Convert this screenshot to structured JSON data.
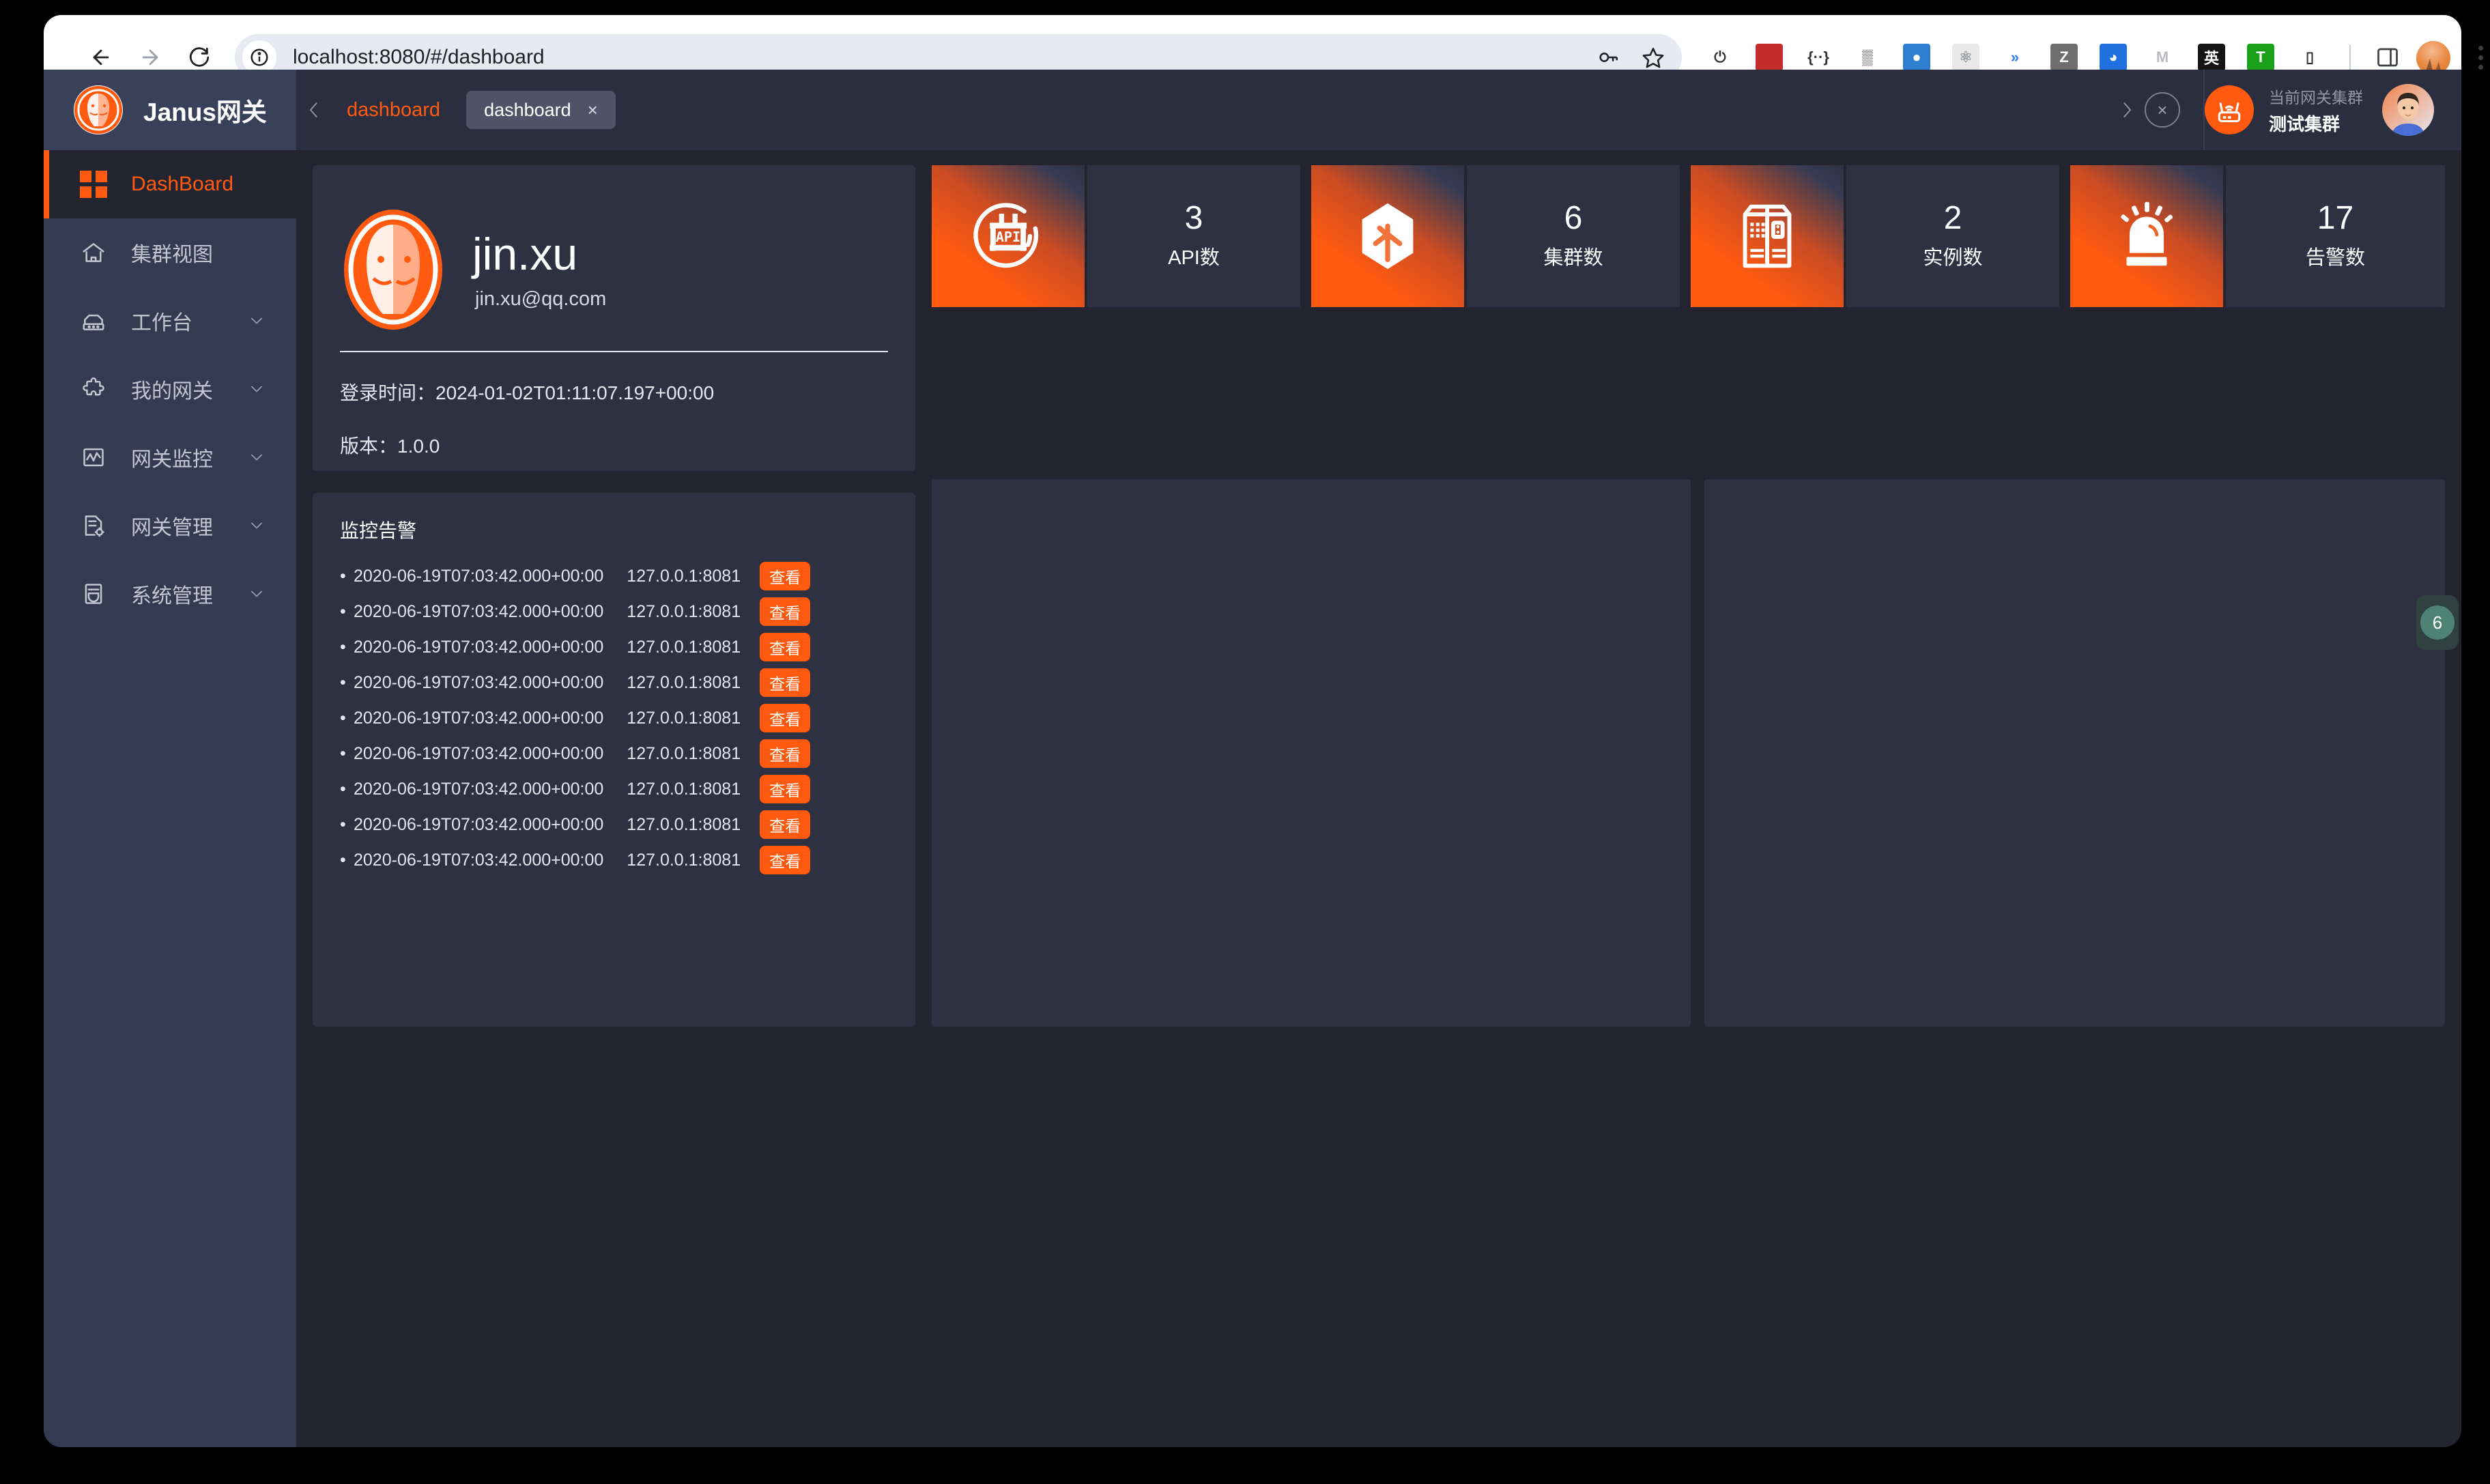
{
  "browser": {
    "url": "localhost:8080/#/dashboard",
    "nav": {
      "back": "back-arrow",
      "forward": "forward-arrow",
      "reload": "reload"
    },
    "omnibox_icons": [
      "password-key-icon",
      "bookmark-star-icon"
    ],
    "extensions": [
      {
        "name": "power-icon",
        "glyph": "⏻",
        "color": "#ffffff",
        "fg": "#333333"
      },
      {
        "name": "red-book-extension-icon",
        "glyph": "",
        "color": "#c42b2b",
        "fg": "#ffffff"
      },
      {
        "name": "oval-brackets-extension-icon",
        "glyph": "{··}",
        "color": "#ffffff",
        "fg": "#333333"
      },
      {
        "name": "qr-code-extension-icon",
        "glyph": "▒",
        "color": "#ffffff",
        "fg": "#222222"
      },
      {
        "name": "globe-extension-icon",
        "glyph": "●",
        "color": "#2f7fd0",
        "fg": "#ffffff"
      },
      {
        "name": "atom-extension-icon",
        "glyph": "⚛",
        "color": "#e9e9e9",
        "fg": "#9aa0a6"
      },
      {
        "name": "double-chevron-down-extension-icon",
        "glyph": "»",
        "color": "#ffffff",
        "fg": "#2d7ff0"
      },
      {
        "name": "z-extension-icon",
        "glyph": "Z",
        "color": "#6e6e6e",
        "fg": "#ffffff"
      },
      {
        "name": "blue-wave-extension-icon",
        "glyph": "◕",
        "color": "#1f6fdd",
        "fg": "#ffffff"
      },
      {
        "name": "m-extension-icon",
        "glyph": "M",
        "color": "#ffffff",
        "fg": "#b9bcc4"
      },
      {
        "name": "translate-extension-icon",
        "glyph": "英",
        "color": "#141414",
        "fg": "#ffffff"
      },
      {
        "name": "t-shield-extension-icon",
        "glyph": "T",
        "color": "#1aa01a",
        "fg": "#ffffff"
      },
      {
        "name": "bottle-extension-icon",
        "glyph": "▯",
        "color": "#ffffff",
        "fg": "#333333"
      }
    ],
    "side_panel_icon": "side-panel-icon",
    "profile_icon": "chrome-profile-avatar",
    "menu_icon": "three-dot-menu-icon"
  },
  "sidebar": {
    "logo_icon": "janus-coin-logo",
    "title": "Janus网关",
    "items": [
      {
        "label": "DashBoard",
        "icon": "dashboard-grid-icon",
        "active": true,
        "expandable": false
      },
      {
        "label": "集群视图",
        "icon": "home-icon",
        "active": false,
        "expandable": false
      },
      {
        "label": "工作台",
        "icon": "workbench-icon",
        "active": false,
        "expandable": true
      },
      {
        "label": "我的网关",
        "icon": "puzzle-gateway-icon",
        "active": false,
        "expandable": true
      },
      {
        "label": "网关监控",
        "icon": "monitor-chart-icon",
        "active": false,
        "expandable": true
      },
      {
        "label": "网关管理",
        "icon": "document-gear-icon",
        "active": false,
        "expandable": true
      },
      {
        "label": "系统管理",
        "icon": "system-shield-icon",
        "active": false,
        "expandable": true
      }
    ]
  },
  "header": {
    "scroll_left_icon": "chevron-left-icon",
    "scroll_right_icon": "chevron-right-icon",
    "breadcrumb": "dashboard",
    "tabs": [
      {
        "label": "dashboard",
        "close_label": "×",
        "active": true
      }
    ],
    "close_all_label": "×",
    "cluster_icon": "router-wifi-icon",
    "cluster_label": "当前网关集群",
    "cluster_name": "测试集群",
    "avatar_icon": "user-avatar"
  },
  "profile": {
    "picture_icon": "janus-coin-avatar",
    "name": "jin.xu",
    "email": "jin.xu@qq.com",
    "login_time_label": "登录时间：",
    "login_time_value": "2024-01-02T01:11:07.197+00:00",
    "version_label": "版本：",
    "version_value": "1.0.0"
  },
  "stats": [
    {
      "icon": "api-circle-icon",
      "value": "3",
      "label": "API数"
    },
    {
      "icon": "cluster-cube-icon",
      "value": "6",
      "label": "集群数"
    },
    {
      "icon": "server-rack-icon",
      "value": "2",
      "label": "实例数"
    },
    {
      "icon": "alarm-siren-icon",
      "value": "17",
      "label": "告警数"
    }
  ],
  "alerts": {
    "title": "监控告警",
    "bullet": "•",
    "action_label": "查看",
    "rows": [
      {
        "time": "2020-06-19T07:03:42.000+00:00",
        "address": "127.0.0.1:8081"
      },
      {
        "time": "2020-06-19T07:03:42.000+00:00",
        "address": "127.0.0.1:8081"
      },
      {
        "time": "2020-06-19T07:03:42.000+00:00",
        "address": "127.0.0.1:8081"
      },
      {
        "time": "2020-06-19T07:03:42.000+00:00",
        "address": "127.0.0.1:8081"
      },
      {
        "time": "2020-06-19T07:03:42.000+00:00",
        "address": "127.0.0.1:8081"
      },
      {
        "time": "2020-06-19T07:03:42.000+00:00",
        "address": "127.0.0.1:8081"
      },
      {
        "time": "2020-06-19T07:03:42.000+00:00",
        "address": "127.0.0.1:8081"
      },
      {
        "time": "2020-06-19T07:03:42.000+00:00",
        "address": "127.0.0.1:8081"
      },
      {
        "time": "2020-06-19T07:03:42.000+00:00",
        "address": "127.0.0.1:8081"
      }
    ]
  },
  "float_badge": {
    "value": "6"
  },
  "colors": {
    "accent": "#FF5A10",
    "page_bg": "#23242F",
    "card_bg": "#2D3142",
    "sidebar_bg": "#343B50",
    "header_bg": "#2B2E3E",
    "badge_green": "#4E8273"
  }
}
